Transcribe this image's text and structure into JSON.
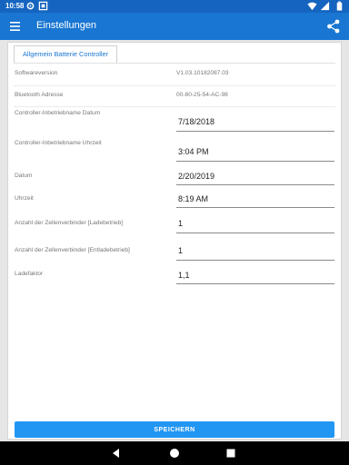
{
  "status_bar": {
    "time": "10:58",
    "icons": [
      "settings-icon",
      "notification-icon",
      "wifi-icon",
      "signal-icon",
      "battery-icon"
    ]
  },
  "app_bar": {
    "title": "Einstellungen",
    "menu_icon": "menu-icon",
    "share_icon": "share-icon",
    "color": "#1976d2"
  },
  "tab": {
    "label": "Allgemein Batterie Controller"
  },
  "info_rows": [
    {
      "label": "Softwareversion",
      "value": "V1.03.10182087.03"
    },
    {
      "label": "Bluetooth Adresse",
      "value": "00-80-25-54-AC-98"
    }
  ],
  "fields": [
    {
      "label": "Controller-Inbetriebname Datum",
      "value": "7/18/2018"
    },
    {
      "label": "Controller-Inbetriebname Uhrzeit",
      "value": "3:04 PM"
    },
    {
      "label": "Datum",
      "value": "2/20/2019"
    },
    {
      "label": "Uhrzeit",
      "value": "8:19 AM"
    },
    {
      "label": "Anzahl der Zellenverbinder [Ladebetrieb]",
      "value": "1"
    },
    {
      "label": "Anzahl der Zellenverbinder [Entladebetrieb]",
      "value": "1"
    },
    {
      "label": "Ladefaktor",
      "value": "1,1"
    }
  ],
  "save_button": {
    "label": "SPEICHERN",
    "color": "#2196f3"
  },
  "nav_bar": {
    "icons": [
      "back-icon",
      "home-icon",
      "recents-icon"
    ]
  }
}
